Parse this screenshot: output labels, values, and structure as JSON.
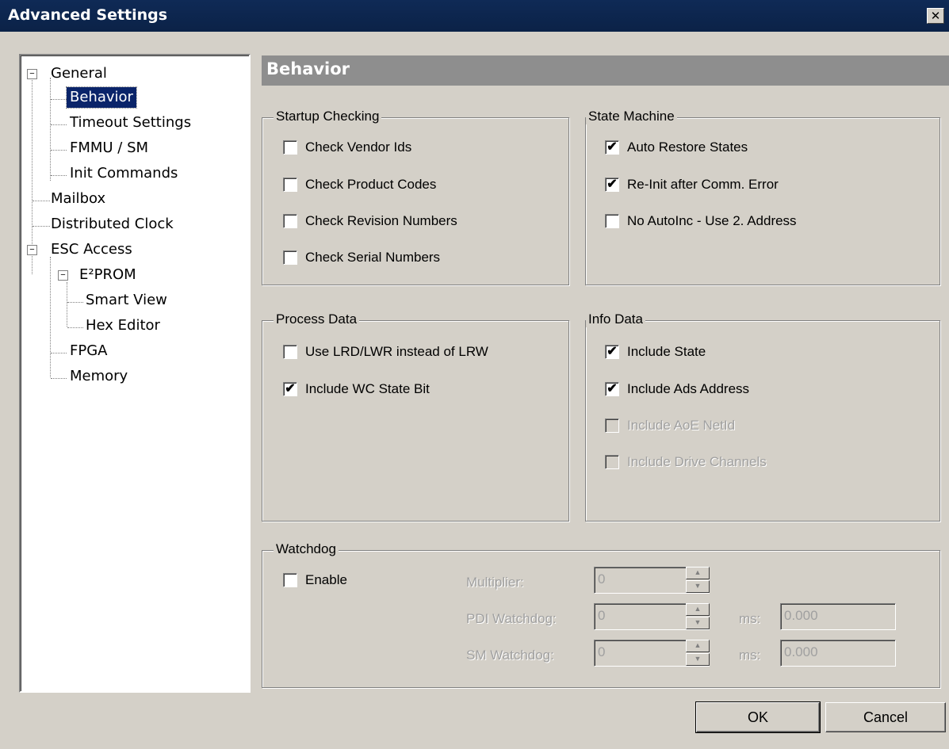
{
  "window": {
    "title": "Advanced Settings",
    "close_glyph": "✕"
  },
  "tree": {
    "items": [
      {
        "label": "General",
        "expander": "−"
      },
      {
        "label": "Behavior"
      },
      {
        "label": "Timeout Settings"
      },
      {
        "label": "FMMU / SM"
      },
      {
        "label": "Init Commands"
      },
      {
        "label": "Mailbox"
      },
      {
        "label": "Distributed Clock"
      },
      {
        "label": "ESC Access",
        "expander": "−"
      },
      {
        "label": "E²PROM",
        "expander": "−"
      },
      {
        "label": "Smart View"
      },
      {
        "label": "Hex Editor"
      },
      {
        "label": "FPGA"
      },
      {
        "label": "Memory"
      }
    ],
    "selected": "Behavior"
  },
  "header": {
    "title": "Behavior"
  },
  "startup": {
    "legend": "Startup Checking",
    "items": [
      {
        "label": "Check Vendor Ids",
        "check": ""
      },
      {
        "label": "Check Product Codes",
        "check": ""
      },
      {
        "label": "Check Revision Numbers",
        "check": ""
      },
      {
        "label": "Check Serial Numbers",
        "check": ""
      }
    ]
  },
  "state_machine": {
    "legend": "State Machine",
    "items": [
      {
        "label": "Auto Restore States",
        "check": "✔"
      },
      {
        "label": "Re-Init after Comm. Error",
        "check": "✔"
      },
      {
        "label": "No AutoInc - Use 2. Address",
        "check": ""
      }
    ]
  },
  "process_data": {
    "legend": "Process Data",
    "items": [
      {
        "label": "Use LRD/LWR instead of LRW",
        "check": ""
      },
      {
        "label": "Include WC State Bit",
        "check": "✔"
      }
    ]
  },
  "info_data": {
    "legend": "Info Data",
    "items": [
      {
        "label": "Include State",
        "check": "✔"
      },
      {
        "label": "Include Ads Address",
        "check": "✔"
      },
      {
        "label": "Include AoE NetId",
        "check": ""
      },
      {
        "label": "Include Drive Channels",
        "check": ""
      }
    ]
  },
  "watchdog": {
    "legend": "Watchdog",
    "enable_label": "Enable",
    "enable_check": "",
    "multiplier_label": "Multiplier:",
    "multiplier_value": "0",
    "pdi_label": "PDI Watchdog:",
    "pdi_value": "0",
    "pdi_ms_label": "ms:",
    "pdi_ms_value": "0.000",
    "sm_label": "SM Watchdog:",
    "sm_value": "0",
    "sm_ms_label": "ms:",
    "sm_ms_value": "0.000",
    "spin_up": "▲",
    "spin_down": "▼"
  },
  "buttons": {
    "ok": "OK",
    "cancel": "Cancel"
  }
}
